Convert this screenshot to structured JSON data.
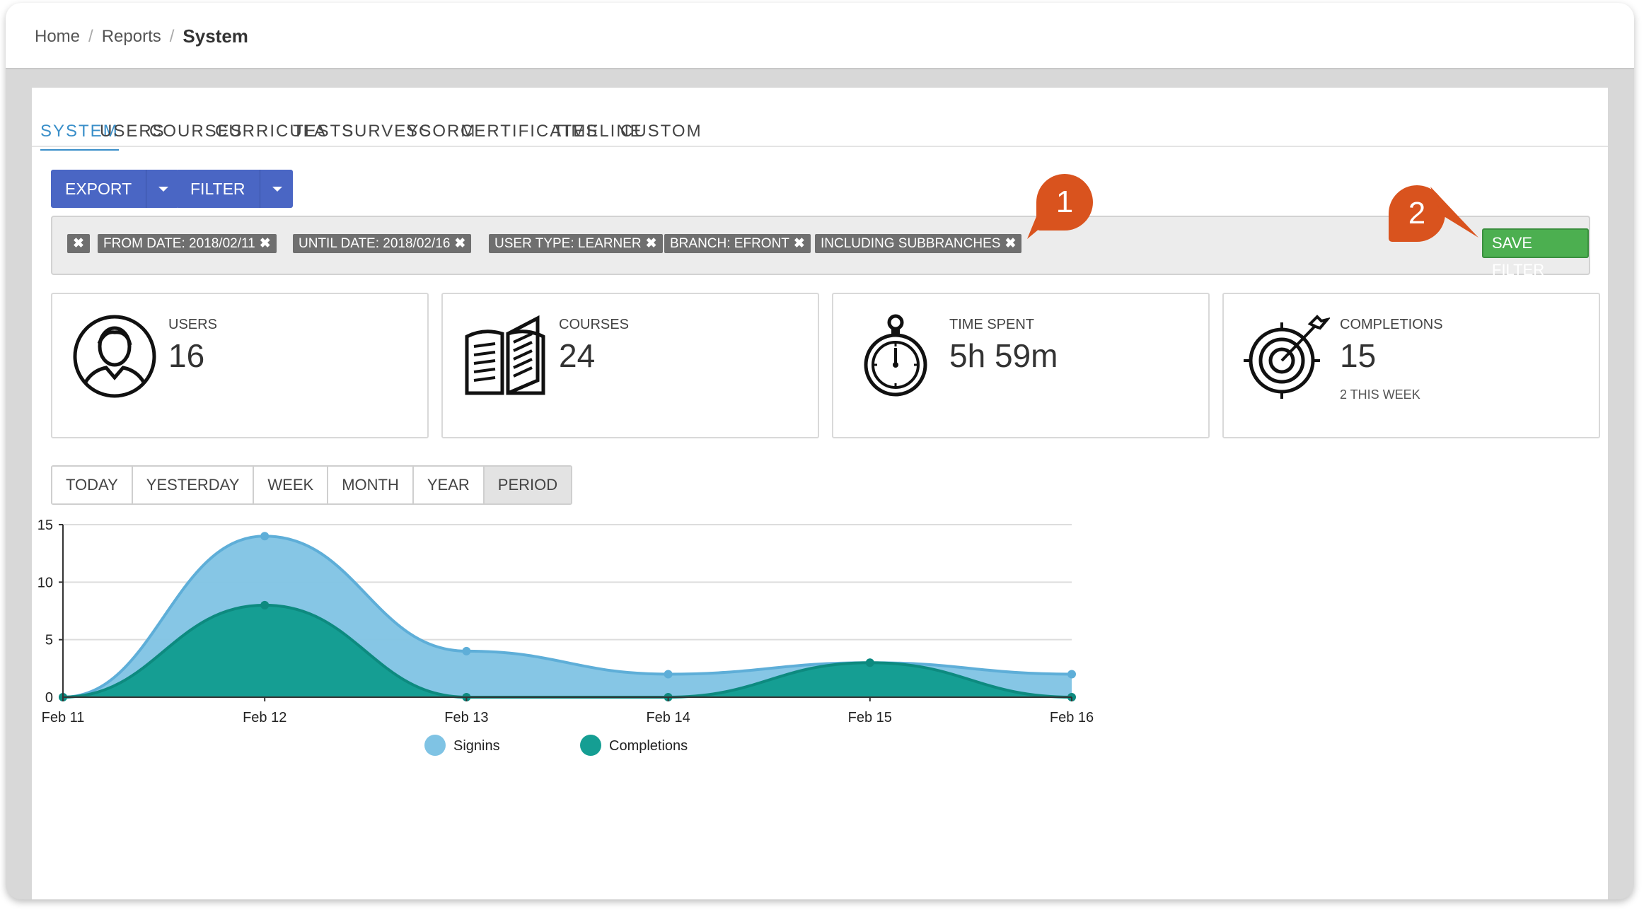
{
  "breadcrumb": {
    "items": [
      "Home",
      "Reports"
    ],
    "current": "System"
  },
  "tabs": [
    "SYSTEM",
    "USERS",
    "COURSES",
    "CURRICULA",
    "TESTS",
    "SURVEYS",
    "SCORM",
    "CERTIFICATES",
    "TIMELINE",
    "CUSTOM"
  ],
  "toolbar": {
    "export_label": "EXPORT",
    "filter_label": "FILTER"
  },
  "filters": {
    "chips": [
      "FROM DATE: 2018/02/11",
      "UNTIL DATE: 2018/02/16",
      "USER TYPE: LEARNER",
      "BRANCH: EFRONT",
      "INCLUDING SUBBRANCHES"
    ],
    "save_label": "SAVE FILTER"
  },
  "cards": [
    {
      "label": "USERS",
      "value": "16",
      "sub": "",
      "icon": "user-icon"
    },
    {
      "label": "COURSES",
      "value": "24",
      "sub": "",
      "icon": "book-icon"
    },
    {
      "label": "TIME SPENT",
      "value": "5h 59m",
      "sub": "",
      "icon": "stopwatch-icon"
    },
    {
      "label": "COMPLETIONS",
      "value": "15",
      "sub": "2 THIS WEEK",
      "icon": "target-icon"
    }
  ],
  "periods": [
    "TODAY",
    "YESTERDAY",
    "WEEK",
    "MONTH",
    "YEAR",
    "PERIOD"
  ],
  "active_period": "PERIOD",
  "markers": [
    "1",
    "2"
  ],
  "colors": {
    "accent": "#3a8fc9",
    "button": "#4a66c4",
    "save": "#4caf50",
    "signins": "#7fc3e4",
    "completions": "#159e93",
    "marker": "#d9531e"
  },
  "chart_data": {
    "type": "area",
    "x": [
      "Feb 11",
      "Feb 12",
      "Feb 13",
      "Feb 14",
      "Feb 15",
      "Feb 16"
    ],
    "series": [
      {
        "name": "Signins",
        "values": [
          0,
          14,
          4,
          2,
          3,
          2
        ]
      },
      {
        "name": "Completions",
        "values": [
          0,
          8,
          0,
          0,
          3,
          0
        ]
      }
    ],
    "ylim": [
      0,
      15
    ],
    "yticks": [
      0,
      5,
      10,
      15
    ],
    "grid": true,
    "legend": "bottom-center"
  }
}
